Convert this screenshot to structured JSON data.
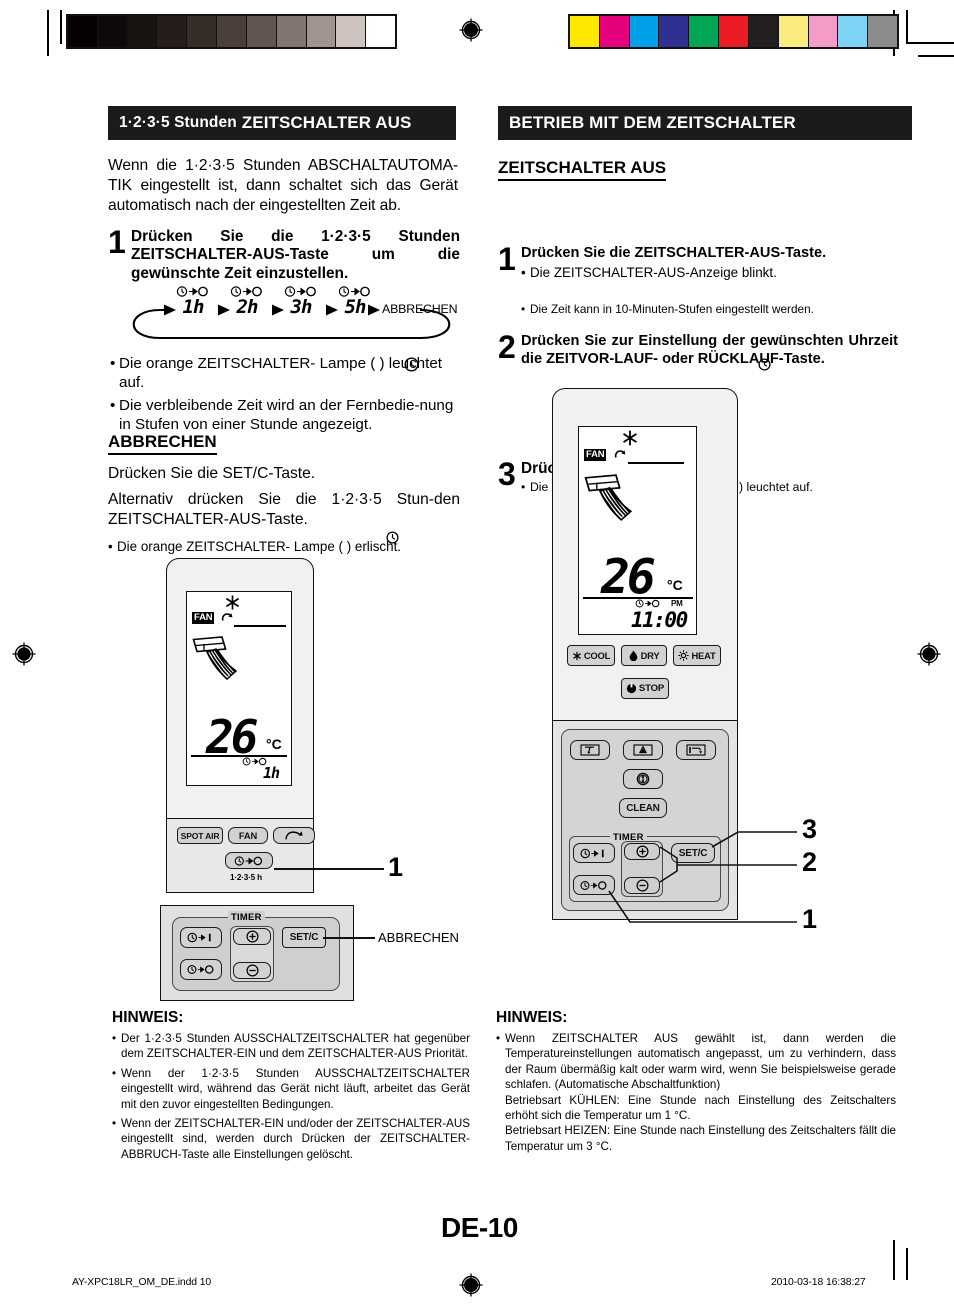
{
  "document": {
    "page_number": "DE-10",
    "footer_file": "AY-XPC18LR_OM_DE.indd   10",
    "footer_date": "2010-03-18   16:38:27"
  },
  "print_marks": {
    "grayscale_swatches": [
      "#050201",
      "#0d0908",
      "#181310",
      "#241d19",
      "#362d28",
      "#4a3f39",
      "#635650",
      "#827570",
      "#a1948f",
      "#cfc3bf",
      "#ffffff"
    ],
    "color_swatches": [
      "#ffe800",
      "#e6007e",
      "#00a0e9",
      "#2e3192",
      "#00a652",
      "#ed1c24",
      "#231f20",
      "#faec7e",
      "#f59bc7",
      "#7fd4f5",
      "#8c8c8c"
    ]
  },
  "left_column": {
    "header": {
      "lead": "1·2·3·5 Stunden",
      "main": "ZEITSCHALTER AUS"
    },
    "intro": "Wenn die 1·2·3·5 Stunden ABSCHALTAUTOMA-TIK eingestellt ist, dann schaltet sich das Gerät automatisch nach der eingestellten Zeit ab.",
    "step1": {
      "number": "1",
      "title": "Drücken Sie die 1·2·3·5 Stunden ZEITSCHALTER-AUS-Taste um die gewünschte Zeit einzustellen."
    },
    "cycle": {
      "items": [
        "1h",
        "2h",
        "3h",
        "5h"
      ],
      "end_label": "ABBRECHEN",
      "timer_icon": "timer-off-icon"
    },
    "bullets": [
      "Die orange ZEITSCHALTER- Lampe (  ) leuchtet auf.",
      "Die verbleibende Zeit wird an der Fernbedie-nung in Stufen von einer Stunde angezeigt."
    ],
    "cancel": {
      "heading": "ABBRECHEN",
      "line1": "Drücken Sie die SET/C-Taste.",
      "line2": "Alternativ drücken Sie die 1·2·3·5 Stun-den ZEITSCHALTER-AUS-Taste.",
      "bullet": "Die orange ZEITSCHALTER- Lampe (  ) erlischt."
    },
    "remote": {
      "lcd": {
        "fan_label": "FAN",
        "temperature": "26",
        "unit": "°C",
        "timer_value": "1h",
        "snowflake_icon": "snowflake-icon",
        "swing_icon": "swing-icon",
        "airflow_icon": "airflow-icon",
        "timer_off_icon": "timer-off-icon"
      },
      "buttons": [
        "SPOT AIR",
        "FAN",
        "SWING"
      ],
      "timer_off_button_sub": "1·2·3·5 h",
      "callout": "1"
    },
    "timer_panel": {
      "group_label": "TIMER",
      "buttons": [
        "TIMER-ON",
        "TIMER-OFF",
        "+",
        "−",
        "SET/C"
      ],
      "set_label": "SET/C",
      "callout_label": "ABBRECHEN"
    },
    "note": {
      "heading": "HINWEIS:",
      "items": [
        "Der 1·2·3·5 Stunden AUSSCHALTZEITSCHALTER hat gegenüber dem ZEITSCHALTER-EIN und dem ZEITSCHALTER-AUS Priorität.",
        "Wenn der 1·2·3·5 Stunden AUSSCHALTZEITSCHALTER eingestellt wird, während das Gerät nicht läuft, arbeitet das Gerät mit den zuvor eingestellten Bedingungen.",
        "Wenn der ZEITSCHALTER-EIN und/oder der ZEITSCHALTER-AUS eingestellt sind, werden durch Drücken der ZEITSCHALTER-ABBRUCH-Taste alle Einstellungen gelöscht."
      ]
    }
  },
  "right_column": {
    "header": {
      "main": "BETRIEB MIT DEM ZEITSCHALTER"
    },
    "subhead": "ZEITSCHALTER AUS",
    "steps": [
      {
        "number": "1",
        "title": "Drücken Sie die ZEITSCHALTER-AUS-Taste.",
        "bullet": "Die ZEITSCHALTER-AUS-Anzeige blinkt."
      },
      {
        "number": "2",
        "title": "Drücken Sie zur Einstellung der gewünschten Uhrzeit die ZEITVOR-LAUF- oder RÜCKLAUF-Taste.",
        "bullet": "Die Zeit kann in 10-Minuten-Stufen eingestellt werden."
      },
      {
        "number": "3",
        "title": "Drücken Sie die SET/C-Taste.",
        "bullet": "Die orange ZEITSCHALTER- Lampe (  ) leuchtet auf."
      }
    ],
    "remote": {
      "lcd": {
        "fan_label": "FAN",
        "temperature": "26",
        "unit": "°C",
        "clock_value": "11:00",
        "meridiem": "PM",
        "snowflake_icon": "snowflake-icon",
        "swing_icon": "swing-icon",
        "airflow_icon": "airflow-icon",
        "timer_off_icon": "timer-off-icon"
      },
      "mode_buttons": [
        "COOL",
        "DRY",
        "HEAT"
      ],
      "stop_button": "STOP",
      "function_buttons": [
        "louver-icon",
        "ion-icon",
        "exhaust-icon",
        "economy-icon"
      ],
      "clean_button": "CLEAN",
      "timer": {
        "group_label": "TIMER",
        "set_label": "SET/C"
      },
      "callouts": [
        "3",
        "2",
        "1"
      ]
    },
    "note": {
      "heading": "HINWEIS:",
      "items": [
        "Wenn ZEITSCHALTER AUS gewählt ist, dann werden die Temperatureinstellungen automatisch angepasst, um zu verhindern, dass der Raum übermäßig kalt oder warm wird, wenn Sie beispielsweise gerade schlafen. (Automatische Abschaltfunktion)\nBetriebsart KÜHLEN: Eine Stunde nach Einstellung des Zeitschalters erhöht sich die Temperatur um 1 °C.\nBetriebsart HEIZEN: Eine Stunde nach Einstellung des Zeitschalters fällt die Temperatur um 3 °C."
      ]
    }
  }
}
